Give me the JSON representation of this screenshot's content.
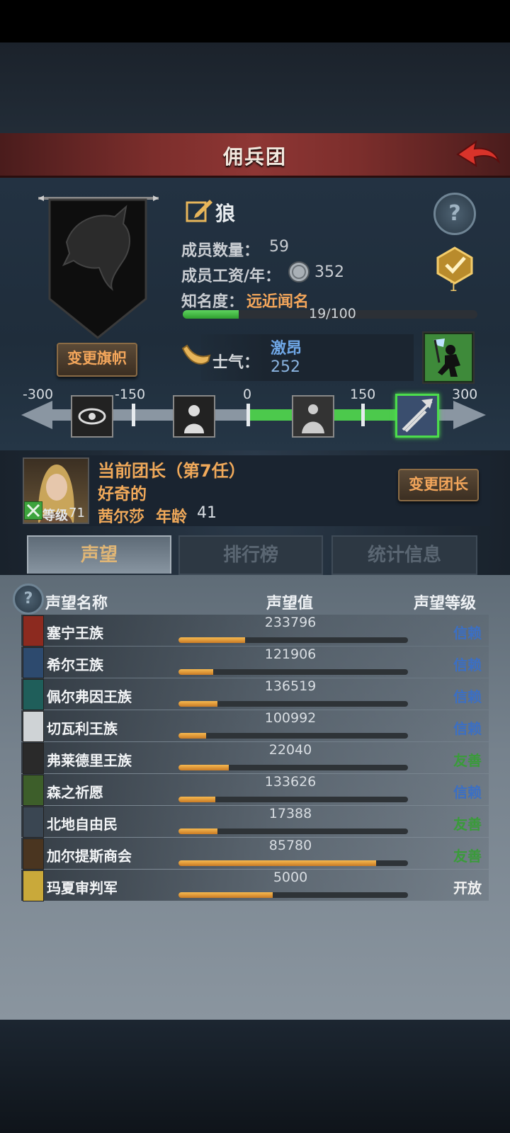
{
  "title": "佣兵团",
  "mercenary": {
    "name": "狼",
    "members_label": "成员数量：",
    "members_value": "59",
    "wage_label": "成员工资/年：",
    "wage_value": "352",
    "fame_label": "知名度：",
    "fame_value": "远近闻名",
    "fame_progress_text": "19/100",
    "fame_progress": 0.19,
    "badge_count": "1",
    "change_banner_label": "变更旗帜"
  },
  "morale": {
    "label": "士气：",
    "state": "激昂",
    "value": "252",
    "scale_ticks": [
      "-300",
      "-150",
      "0",
      "150",
      "300"
    ]
  },
  "leader": {
    "title": "当前团长（第7任）",
    "trait": "好奇的",
    "name": "茜尔莎",
    "age_label": "年龄",
    "age": "41",
    "level_label": "等级",
    "level": "71",
    "change_leader_label": "变更团长"
  },
  "tabs": [
    {
      "label": "声望",
      "active": true
    },
    {
      "label": "排行榜",
      "active": false
    },
    {
      "label": "统计信息",
      "active": false
    }
  ],
  "reputation_header": {
    "name": "声望名称",
    "value": "声望值",
    "level": "声望等级"
  },
  "reputation": [
    {
      "name": "塞宁王族",
      "value": "233796",
      "level": "信赖",
      "level_color": "#3b6fc4",
      "icon_color": "#8c2a1f",
      "progress": 0.29
    },
    {
      "name": "希尔王族",
      "value": "121906",
      "level": "信赖",
      "level_color": "#3b6fc4",
      "icon_color": "#2d4a6e",
      "progress": 0.15
    },
    {
      "name": "佩尔弗因王族",
      "value": "136519",
      "level": "信赖",
      "level_color": "#3b6fc4",
      "icon_color": "#1f5e5a",
      "progress": 0.17
    },
    {
      "name": "切瓦利王族",
      "value": "100992",
      "level": "信赖",
      "level_color": "#3b6fc4",
      "icon_color": "#cfd3d6",
      "progress": 0.12
    },
    {
      "name": "弗莱德里王族",
      "value": "22040",
      "level": "友善",
      "level_color": "#3a9b3a",
      "icon_color": "#2a2a2a",
      "progress": 0.22
    },
    {
      "name": "森之祈愿",
      "value": "133626",
      "level": "信赖",
      "level_color": "#3b6fc4",
      "icon_color": "#3d5e2a",
      "progress": 0.16
    },
    {
      "name": "北地自由民",
      "value": "17388",
      "level": "友善",
      "level_color": "#3a9b3a",
      "icon_color": "#3a4652",
      "progress": 0.17
    },
    {
      "name": "加尔提斯商会",
      "value": "85780",
      "level": "友善",
      "level_color": "#3a9b3a",
      "icon_color": "#4a3520",
      "progress": 0.86
    },
    {
      "name": "玛夏审判军",
      "value": "5000",
      "level": "开放",
      "level_color": "#f2f2f2",
      "icon_color": "#c9a93a",
      "progress": 0.41
    }
  ]
}
